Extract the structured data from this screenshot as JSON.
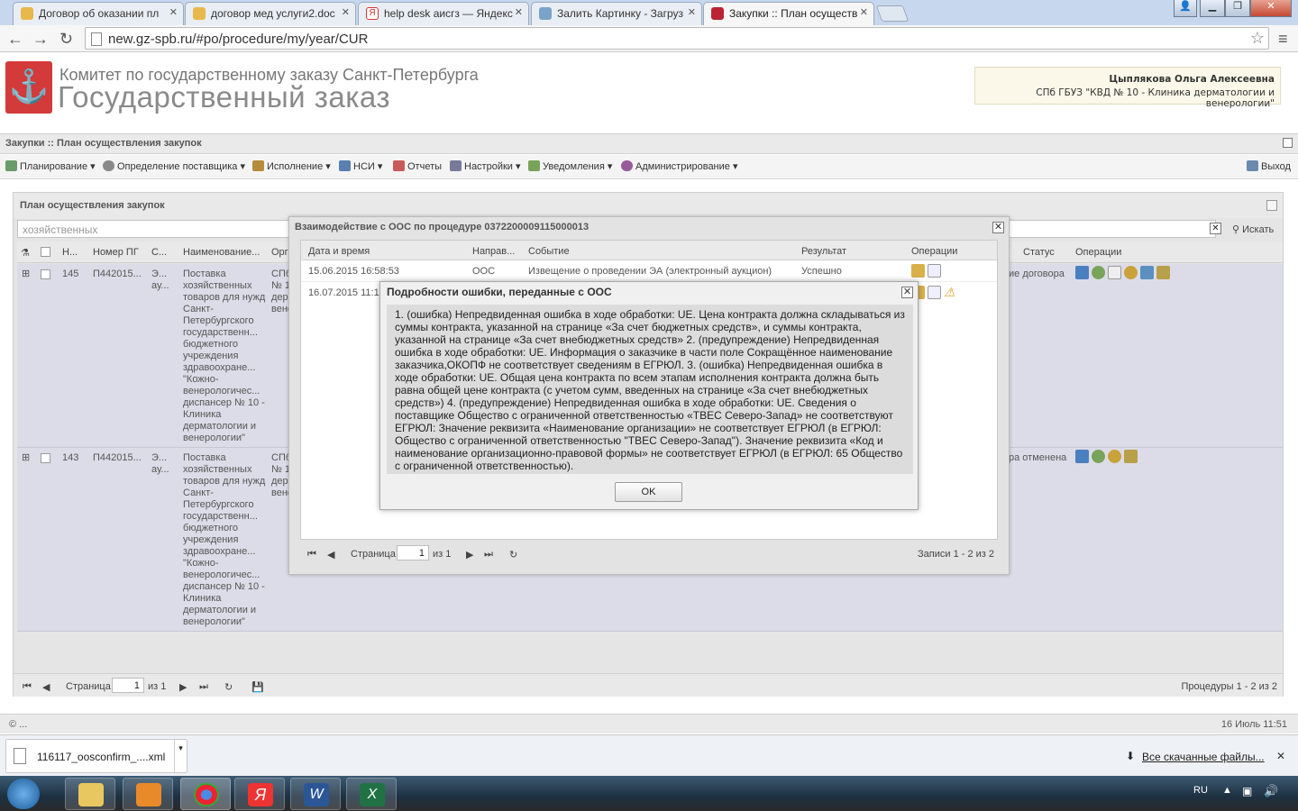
{
  "browser": {
    "tabs": [
      {
        "title": "Договор об оказании пл",
        "icon": "chrome-icon"
      },
      {
        "title": "договор мед услуги2.doc",
        "icon": "chrome-icon"
      },
      {
        "title": "help desk аисгз — Яндекс",
        "icon": "yandex-icon"
      },
      {
        "title": "Залить Картинку - Загруз",
        "icon": "image-host-icon"
      },
      {
        "title": "Закупки :: План осуществ",
        "icon": "gavel-icon"
      }
    ],
    "url": "new.gz-spb.ru/#po/procedure/my/year/CUR"
  },
  "header": {
    "org": "Комитет по государственному заказу Санкт-Петербурга",
    "system": "Государственный заказ",
    "user_name": "Цыплякова Ольга Алексеевна",
    "user_org": "СПб ГБУЗ \"КВД № 10 - Клиника дерматологии и венерологии\""
  },
  "section_title": "Закупки :: План осуществления закупок",
  "menu": {
    "items": [
      "Планирование",
      "Определение поставщика",
      "Исполнение",
      "НСИ",
      "Отчеты",
      "Настройки",
      "Уведомления",
      "Администрирование"
    ],
    "exit": "Выход"
  },
  "main": {
    "title": "План осуществления закупок",
    "search_value": "хозяйственных",
    "search_button": "Искать",
    "columns": [
      "Н...",
      "Номер ПГ",
      "С...",
      "Наименование...",
      "Орг",
      "Статус",
      "Операции"
    ],
    "rows": [
      {
        "num": "145",
        "pg": "П442015...",
        "s": "Э... ау...",
        "name": "Поставка хозяйственных товаров для нужд Санкт-Петербургского государственн... бюджетного учреждения здравоохране... \"Кожно-венерологичес... диспансер № 10 - Клиника дерматологии и венерологии\"",
        "org": "СПб № 1 дерм вене",
        "status": "ие договора"
      },
      {
        "num": "143",
        "pg": "П442015...",
        "s": "Э... ау...",
        "name": "Поставка хозяйственных товаров для нужд Санкт-Петербургского государственн... бюджетного учреждения здравоохране... \"Кожно-венерологичес... диспансер № 10 - Клиника дерматологии и венерологии\"",
        "org": "СПб № 1 дерм вене",
        "status": "ра отменена"
      }
    ],
    "pager": {
      "page_label": "Страница",
      "page": "1",
      "of": "из 1",
      "summary": "Процедуры 1 - 2 из 2"
    }
  },
  "dialog_oos": {
    "title": "Взаимодействие с ООС по процедуре 0372200009115000013",
    "columns": [
      "Дата и время",
      "Направ...",
      "Событие",
      "Результат",
      "Операции"
    ],
    "rows": [
      {
        "date": "15.06.2015 16:58:53",
        "dir": "ООС",
        "event": "Извещение о проведении ЭА (электронный аукцион)",
        "result": "Успешно"
      },
      {
        "date": "16.07.2015 11:1",
        "dir": "",
        "event": "",
        "result": ""
      }
    ],
    "pager": {
      "page_label": "Страница",
      "page": "1",
      "of": "из 1",
      "summary": "Записи 1 - 2 из 2"
    }
  },
  "dialog_error": {
    "title": "Подробности ошибки, переданные с ООС",
    "text": "1. (ошибка) Непредвиденная ошибка в ходе обработки: UE. Цена контракта должна складываться из суммы контракта, указанной на странице «За счет бюджетных средств», и суммы контракта, указанной на странице «За счет внебюджетных средств» 2. (предупреждение) Непредвиденная ошибка в ходе обработки: UE. Информация о заказчике в части поле Сокращённое наименование заказчика,ОКОПФ не соответствует сведениям в ЕГРЮЛ. 3. (ошибка) Непредвиденная ошибка в ходе обработки: UE. Общая цена контракта по всем этапам исполнения контракта должна быть равна общей цене контракта (с учетом сумм, введенных на странице «За счет внебюджетных средств») 4. (предупреждение) Непредвиденная ошибка в ходе обработки: UE. Сведения о поставщике Общество с ограниченной ответственностью «ТВЕС Северо-Запад» не соответствуют ЕГРЮЛ: Значение реквизита «Наименование организации» не соответствует ЕГРЮЛ (в ЕГРЮЛ: Общество с ограниченной ответственностью \"ТВЕС Северо-Запад\"). Значение реквизита «Код и наименование организационно-правовой формы» не соответствует ЕГРЮЛ (в ЕГРЮЛ: 65 Общество с ограниченной ответственностью).",
    "ok": "OK"
  },
  "status_bar": {
    "left": "© ...",
    "datetime": "16 Июль 11:51"
  },
  "downloads": {
    "file": "116117_oosconfirm_....xml",
    "all": "Все скачанные файлы..."
  },
  "taskbar": {
    "lang": "RU"
  }
}
